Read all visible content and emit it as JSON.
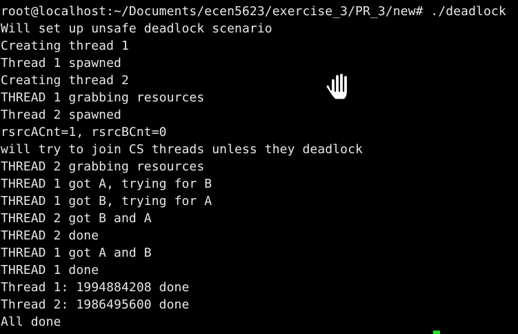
{
  "terminal": {
    "lines": [
      "root@localhost:~/Documents/ecen5623/exercise_3/PR_3/new# ./deadlock",
      "Will set up unsafe deadlock scenario",
      "Creating thread 1",
      "Thread 1 spawned",
      "Creating thread 2",
      "THREAD 1 grabbing resources",
      "Thread 2 spawned",
      "rsrcACnt=1, rsrcBCnt=0",
      "will try to join CS threads unless they deadlock",
      "THREAD 2 grabbing resources",
      "THREAD 1 got A, trying for B",
      "THREAD 1 got B, trying for A",
      "THREAD 2 got B and A",
      "THREAD 2 done",
      "THREAD 1 got A and B",
      "THREAD 1 done",
      "Thread 1: 1994884208 done",
      "Thread 2: 1986495600 done",
      "All done"
    ],
    "background_color": "#000000",
    "text_color": "#e8e8e8",
    "cursor_color": "#22dd22"
  },
  "overlay": {
    "pointer_icon": "hand-grab-icon"
  }
}
